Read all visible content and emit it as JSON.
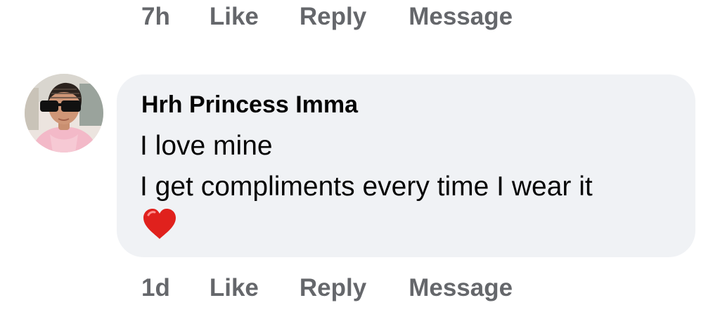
{
  "top_actions": {
    "time": "7h",
    "like": "Like",
    "reply": "Reply",
    "message": "Message"
  },
  "comment": {
    "author": "Hrh Princess Imma",
    "lines": [
      "I love mine",
      "I get compliments every time I wear it"
    ],
    "emoji": "heart-emoji",
    "time": "1d",
    "like": "Like",
    "reply": "Reply",
    "message": "Message"
  },
  "colors": {
    "action_text": "#65676b",
    "bubble_bg": "#f0f2f5",
    "body_text": "#050505",
    "heart": "#e0211d"
  }
}
